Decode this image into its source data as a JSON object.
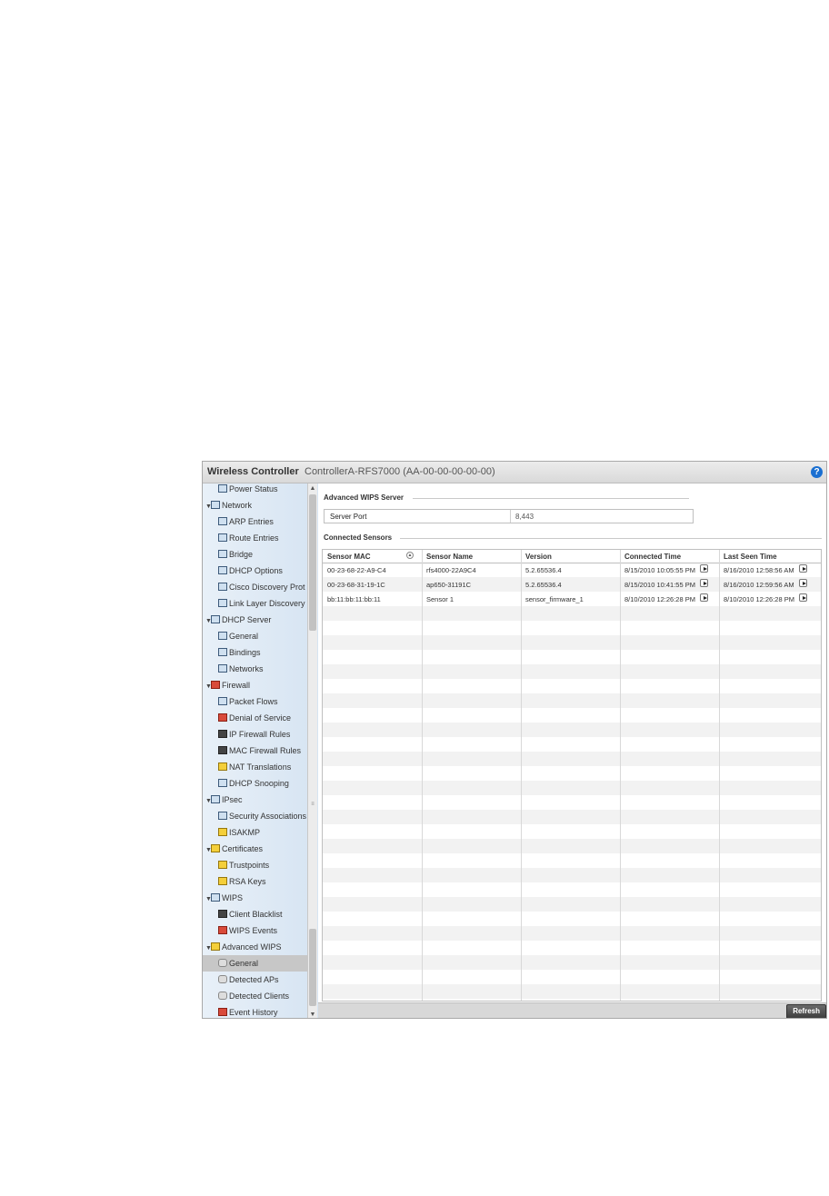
{
  "titlebar": {
    "app_title": "Wireless Controller",
    "device": "ControllerA-RFS7000 (AA-00-00-00-00-00)",
    "help_icon": "?"
  },
  "sidebar": {
    "items": [
      {
        "label": "Power Status",
        "level": 1,
        "icon": "stats-icon"
      },
      {
        "label": "Network",
        "level": 0,
        "icon": "network-icon",
        "expanded": true
      },
      {
        "label": "ARP Entries",
        "level": 1,
        "icon": "stats-icon"
      },
      {
        "label": "Route Entries",
        "level": 1,
        "icon": "stats-icon"
      },
      {
        "label": "Bridge",
        "level": 1,
        "icon": "bridge-icon"
      },
      {
        "label": "DHCP Options",
        "level": 1,
        "icon": "network-icon"
      },
      {
        "label": "Cisco Discovery Prot",
        "level": 1,
        "icon": "network-icon"
      },
      {
        "label": "Link Layer Discovery",
        "level": 1,
        "icon": "network-icon"
      },
      {
        "label": "DHCP Server",
        "level": 0,
        "icon": "network-icon",
        "expanded": true
      },
      {
        "label": "General",
        "level": 1,
        "icon": "network-icon"
      },
      {
        "label": "Bindings",
        "level": 1,
        "icon": "network-icon"
      },
      {
        "label": "Networks",
        "level": 1,
        "icon": "network-icon"
      },
      {
        "label": "Firewall",
        "level": 0,
        "icon": "firewall-icon",
        "expanded": true
      },
      {
        "label": "Packet Flows",
        "level": 1,
        "icon": "packet-flow-icon"
      },
      {
        "label": "Denial of Service",
        "level": 1,
        "icon": "denial-of-service-icon"
      },
      {
        "label": "IP Firewall Rules",
        "level": 1,
        "icon": "ip-rules-icon"
      },
      {
        "label": "MAC Firewall Rules",
        "level": 1,
        "icon": "mac-rules-icon"
      },
      {
        "label": "NAT Translations",
        "level": 1,
        "icon": "nat-icon"
      },
      {
        "label": "DHCP Snooping",
        "level": 1,
        "icon": "snooping-icon"
      },
      {
        "label": "IPsec",
        "level": 0,
        "icon": "ipsec-icon",
        "expanded": true
      },
      {
        "label": "Security Associations",
        "level": 1,
        "icon": "security-icon"
      },
      {
        "label": "ISAKMP",
        "level": 1,
        "icon": "key-icon"
      },
      {
        "label": "Certificates",
        "level": 0,
        "icon": "certificate-icon",
        "expanded": true
      },
      {
        "label": "Trustpoints",
        "level": 1,
        "icon": "certificate-icon"
      },
      {
        "label": "RSA Keys",
        "level": 1,
        "icon": "certificate-icon"
      },
      {
        "label": "WIPS",
        "level": 0,
        "icon": "wips-icon",
        "expanded": true
      },
      {
        "label": "Client Blacklist",
        "level": 1,
        "icon": "blacklist-icon"
      },
      {
        "label": "WIPS Events",
        "level": 1,
        "icon": "event-flag-icon"
      },
      {
        "label": "Advanced WIPS",
        "level": 0,
        "icon": "advanced-wips-icon",
        "expanded": true
      },
      {
        "label": "General",
        "level": 1,
        "icon": "general-icon",
        "selected": true
      },
      {
        "label": "Detected APs",
        "level": 1,
        "icon": "ap-icon"
      },
      {
        "label": "Detected Clients",
        "level": 1,
        "icon": "client-icon"
      },
      {
        "label": "Event History",
        "level": 1,
        "icon": "event-flag-icon"
      }
    ]
  },
  "server": {
    "section_title": "Advanced WIPS Server",
    "port_label": "Server Port",
    "port_value": "8,443"
  },
  "sensors": {
    "section_title": "Connected Sensors",
    "columns": [
      "Sensor MAC",
      "Sensor Name",
      "Version",
      "Connected Time",
      "Last Seen Time"
    ],
    "rows": [
      [
        "00-23-68-22-A9-C4",
        "rfs4000-22A9C4",
        "5.2.65536.4",
        "8/15/2010 10:05:55 PM",
        "8/16/2010 12:58:56 AM"
      ],
      [
        "00-23-68-31-19-1C",
        "ap650-31191C",
        "5.2.65536.4",
        "8/15/2010 10:41:55 PM",
        "8/16/2010 12:59:56 AM"
      ],
      [
        "bb:11:bb:11:bb:11",
        "Sensor 1",
        "sensor_firmware_1",
        "8/10/2010 12:26:28 PM",
        "8/10/2010 12:26:28 PM"
      ]
    ],
    "empty_rows": 28
  },
  "footer": {
    "refresh_label": "Refresh"
  },
  "colors": {
    "sidebar_bg": "#dde8f4",
    "selected_bg": "#c7c7c7",
    "help_blue": "#1a6fd1",
    "button_dark": "#4a4a4a"
  }
}
